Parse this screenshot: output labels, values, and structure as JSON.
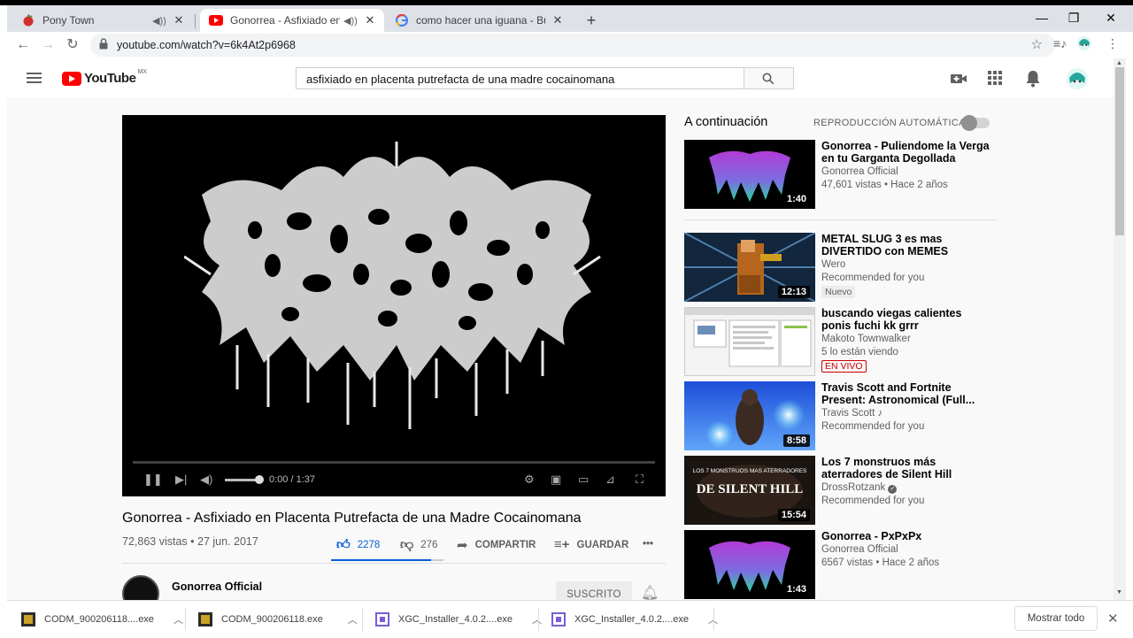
{
  "browser": {
    "tabs": [
      {
        "title": "Pony Town",
        "favicon": "apple-icon",
        "audio": true
      },
      {
        "title": "Gonorrea - Asfixiado en Plac",
        "favicon": "youtube-icon",
        "audio": true,
        "active": true
      },
      {
        "title": "como hacer una iguana - Búsque",
        "favicon": "google-icon",
        "audio": false
      }
    ],
    "new_tab": "+",
    "url": "youtube.com/watch?v=6k4At2p6968"
  },
  "youtube": {
    "logo": "YouTube",
    "region": "MX",
    "search_query": "asfixiado en placenta putrefacta de una madre cocainomana"
  },
  "video": {
    "title": "Gonorrea - Asfixiado en Placenta Putrefacta de una Madre Cocainomana",
    "views": "72,863 vistas",
    "date": "27 jun. 2017",
    "time": "0:00 / 1:37",
    "likes": "2278",
    "dislikes": "276",
    "like_ratio": 0.892,
    "share": "COMPARTIR",
    "save": "GUARDAR",
    "more": "•••",
    "channel": "Gonorrea Official",
    "subscribe": "SUSCRITO"
  },
  "sidebar": {
    "up_next": "A continuación",
    "autoplay": "REPRODUCCIÓN AUTOMÁTICA",
    "autoplay_on": false,
    "items": [
      {
        "title": "Gonorrea - Puliendome la Verga en tu Garganta Degollada",
        "channel": "Gonorrea Official",
        "meta": "47,601 vistas • Hace 2 años",
        "duration": "1:40"
      },
      {
        "title": "METAL SLUG 3 es mas DIVERTIDO con MEMES",
        "channel": "Wero",
        "meta": "Recommended for you",
        "badge": "Nuevo",
        "duration": "12:13"
      },
      {
        "title": "buscando viegas calientes ponis fuchi kk grrr",
        "channel": "Makoto Townwalker",
        "meta": "5 lo están viendo",
        "badge": "EN VIVO",
        "duration": ""
      },
      {
        "title": "Travis Scott and Fortnite Present: Astronomical (Full...",
        "channel": "Travis Scott",
        "channel_icon": "music-note-icon",
        "meta": "Recommended for you",
        "duration": "8:58"
      },
      {
        "title": "Los 7 monstruos más aterradores de Silent Hill",
        "channel": "DrossRotzank",
        "channel_icon": "verified-icon",
        "meta": "Recommended for you",
        "duration": "15:54",
        "thumb_text_top": "LOS 7 MONSTRUOS MAS ATERRADORES",
        "thumb_text_main": "DE SILENT HILL"
      },
      {
        "title": "Gonorrea - PxPxPx",
        "channel": "Gonorrea Official",
        "meta": "6567 vistas • Hace 2 años",
        "duration": "1:43"
      }
    ]
  },
  "downloads": [
    {
      "name": "CODM_900206118....exe"
    },
    {
      "name": "CODM_900206118.exe"
    },
    {
      "name": "XGC_Installer_4.0.2....exe"
    },
    {
      "name": "XGC_Installer_4.0.2....exe"
    }
  ],
  "show_all": "Mostrar todo"
}
